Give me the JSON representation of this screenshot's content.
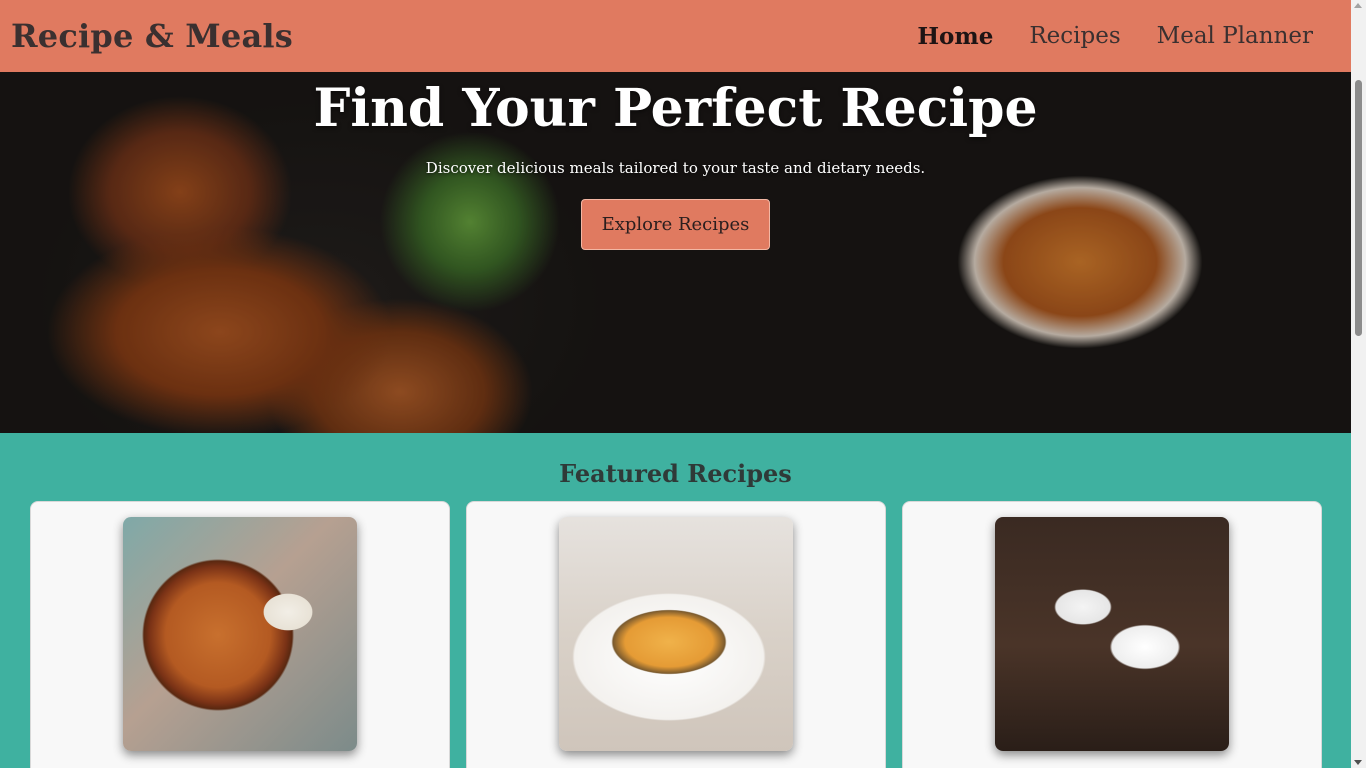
{
  "header": {
    "brand": "Recipe & Meals",
    "nav": [
      {
        "label": "Home",
        "active": true
      },
      {
        "label": "Recipes",
        "active": false
      },
      {
        "label": "Meal Planner",
        "active": false
      }
    ]
  },
  "hero": {
    "title": "Find Your Perfect Recipe",
    "subtitle": "Discover delicious meals tailored to your taste and dietary needs.",
    "button_label": "Explore Recipes"
  },
  "featured": {
    "title": "Featured Recipes",
    "cards": [
      {
        "image": "curry-with-rice-photo"
      },
      {
        "image": "shepherds-pie-photo"
      },
      {
        "image": "chocolate-souffle-photo"
      }
    ]
  },
  "colors": {
    "header_bg": "#e07a60",
    "accent": "#e07a60",
    "section_bg": "#3fb1a0",
    "card_bg": "#f8f8f8"
  }
}
